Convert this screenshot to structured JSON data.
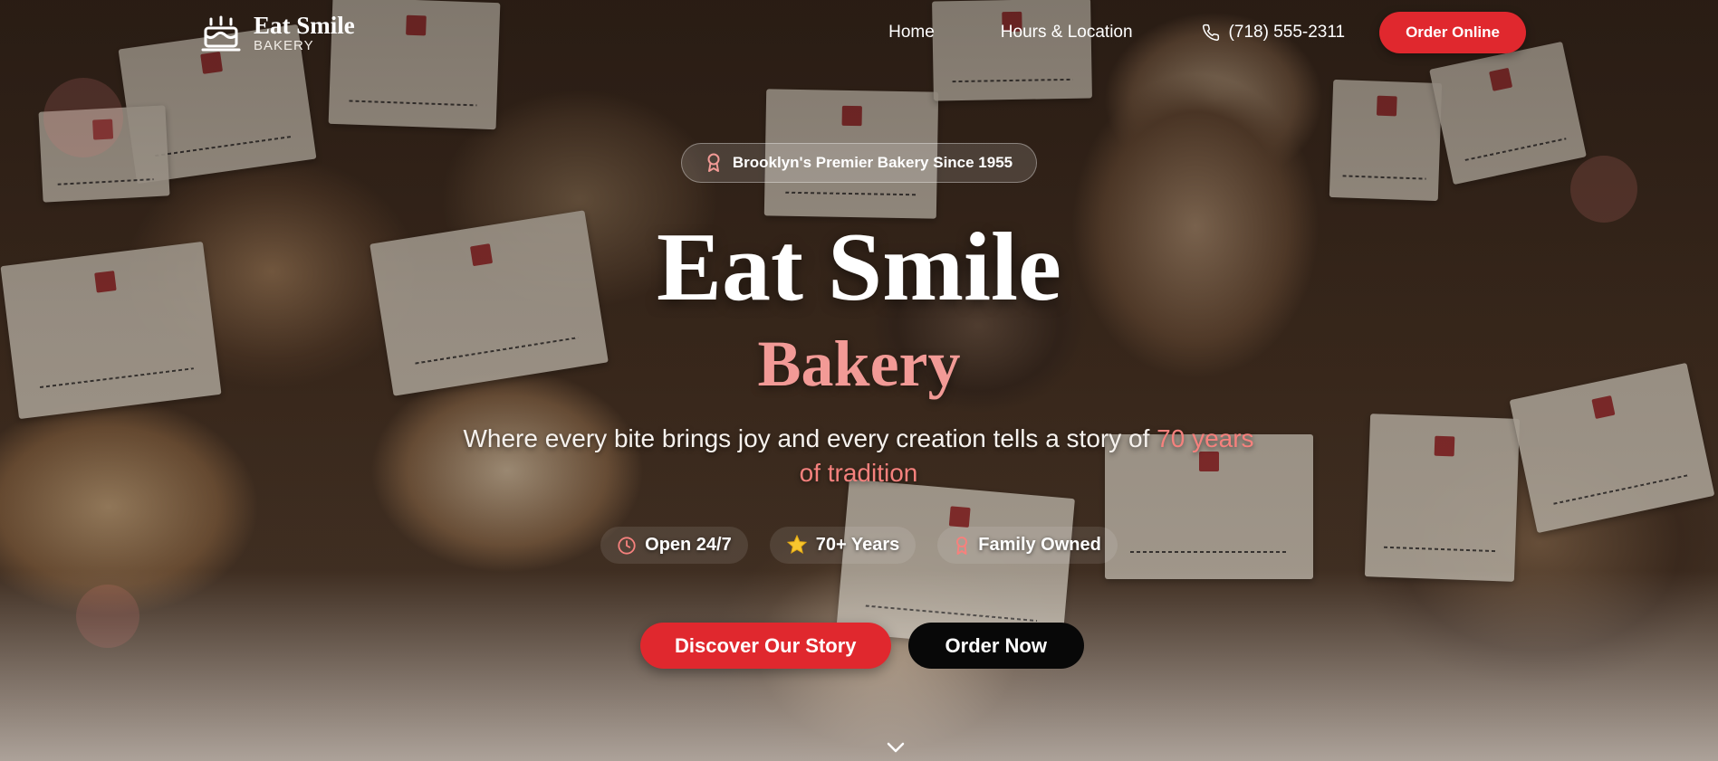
{
  "header": {
    "brand_name": "Eat Smile",
    "brand_sub": "BAKERY",
    "logo_icon": "cake-icon",
    "nav": [
      {
        "label": "Home"
      },
      {
        "label": "Hours & Location"
      }
    ],
    "phone": "(718) 555-2311",
    "phone_icon": "phone-icon",
    "cta": "Order Online"
  },
  "hero": {
    "badge": "Brooklyn's Premier Bakery Since 1955",
    "badge_icon": "award-icon",
    "title": "Eat Smile",
    "subtitle": "Bakery",
    "tagline_main": "Where every bite brings joy and every creation tells a story of ",
    "tagline_highlight": "70 years of tradition",
    "features": [
      {
        "icon": "clock-icon",
        "label": "Open 24/7"
      },
      {
        "icon": "star-icon",
        "label": "70+ Years"
      },
      {
        "icon": "heart-icon",
        "label": "Family Owned"
      }
    ],
    "primary_cta": "Discover Our Story",
    "secondary_cta": "Order Now",
    "scroll_icon": "chevron-down-icon"
  },
  "colors": {
    "accent_red": "#e0282e",
    "accent_pink": "#f29a96",
    "button_black": "#080808"
  }
}
